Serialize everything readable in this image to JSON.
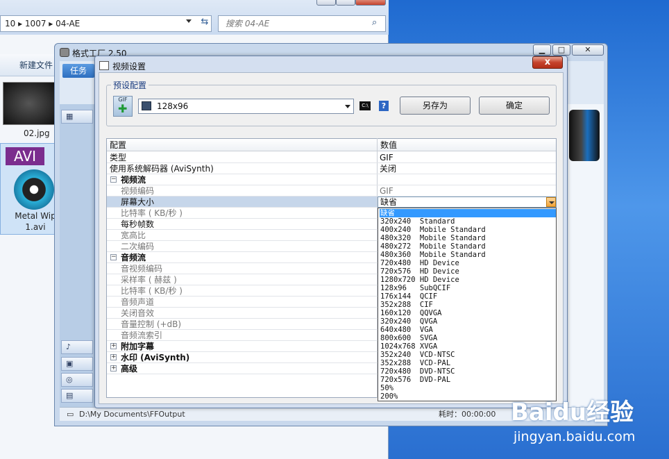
{
  "explorer": {
    "address": "10  ▸  1007  ▸  04-AE",
    "search_placeholder": "搜索 04-AE",
    "new_folder": "新建文件",
    "files": [
      {
        "name": "02.jpg"
      },
      {
        "name": "Metal Wip\n1.avi",
        "tag": "AVI"
      }
    ]
  },
  "formatfactory": {
    "title": "格式工厂 2.50",
    "task_tab": "任务",
    "status_path": "D:\\My Documents\\FFOutput",
    "status_right": "耗时：00:00:00"
  },
  "dialog": {
    "title": "视频设置",
    "close_label": "x",
    "preset_group": "预设配置",
    "preset_value": "128x96",
    "saveas_button": "另存为",
    "ok_button": "确定",
    "help_label": "?",
    "cmd_label": "C:\\",
    "gif_label": "GIF",
    "grid": {
      "col_config": "配置",
      "col_value": "数值",
      "rows": [
        {
          "name": "类型",
          "value": "GIF",
          "kind": "top"
        },
        {
          "name": "使用系统解码器 (AviSynth)",
          "value": "关闭",
          "kind": "top"
        },
        {
          "name": "视频流",
          "value": "",
          "kind": "group",
          "sign": "−"
        },
        {
          "name": "视频编码",
          "value": "GIF",
          "kind": "sub",
          "dim": true
        },
        {
          "name": "屏幕大小",
          "value": "缺省",
          "kind": "sub-sel"
        },
        {
          "name": "比特率 ( KB/秒 )",
          "value": "",
          "kind": "sub"
        },
        {
          "name": "每秒帧数",
          "value": "",
          "kind": "sub-dark"
        },
        {
          "name": "宽高比",
          "value": "",
          "kind": "sub"
        },
        {
          "name": "二次编码",
          "value": "",
          "kind": "sub"
        },
        {
          "name": "音频流",
          "value": "",
          "kind": "group",
          "sign": "−"
        },
        {
          "name": "音视频编码",
          "value": "",
          "kind": "sub"
        },
        {
          "name": "采样率 ( 赫兹 )",
          "value": "",
          "kind": "sub"
        },
        {
          "name": "比特率 ( KB/秒 )",
          "value": "",
          "kind": "sub"
        },
        {
          "name": "音频声道",
          "value": "",
          "kind": "sub"
        },
        {
          "name": "关闭音效",
          "value": "",
          "kind": "sub"
        },
        {
          "name": "音量控制 (+dB)",
          "value": "",
          "kind": "sub"
        },
        {
          "name": "音频流索引",
          "value": "",
          "kind": "sub"
        },
        {
          "name": "附加字幕",
          "value": "",
          "kind": "group",
          "sign": "+"
        },
        {
          "name": "水印 (AviSynth)",
          "value": "",
          "kind": "group",
          "sign": "+"
        },
        {
          "name": "高级",
          "value": "",
          "kind": "group",
          "sign": "+"
        }
      ]
    },
    "dropdown": {
      "items": [
        "缺省",
        "320x240  Standard",
        "400x240  Mobile Standard",
        "480x320  Mobile Standard",
        "480x272  Mobile Standard",
        "480x360  Mobile Standard",
        "720x480  HD Device",
        "720x576  HD Device",
        "1280x720 HD Device",
        "128x96   SubQCIF",
        "176x144  QCIF",
        "352x288  CIF",
        "160x120  QQVGA",
        "320x240  QVGA",
        "640x480  VGA",
        "800x600  SVGA",
        "1024x768 XVGA",
        "352x240  VCD-NTSC",
        "352x288  VCD-PAL",
        "720x480  DVD-NTSC",
        "720x576  DVD-PAL",
        "50%",
        "200%"
      ],
      "selected_index": 0
    }
  },
  "watermark": {
    "brand": "Baidu经验",
    "url": "jingyan.baidu.com"
  },
  "colors": {
    "selection": "#3399ff",
    "close": "#c5422c",
    "accent_tab": "#2d6fc0"
  }
}
